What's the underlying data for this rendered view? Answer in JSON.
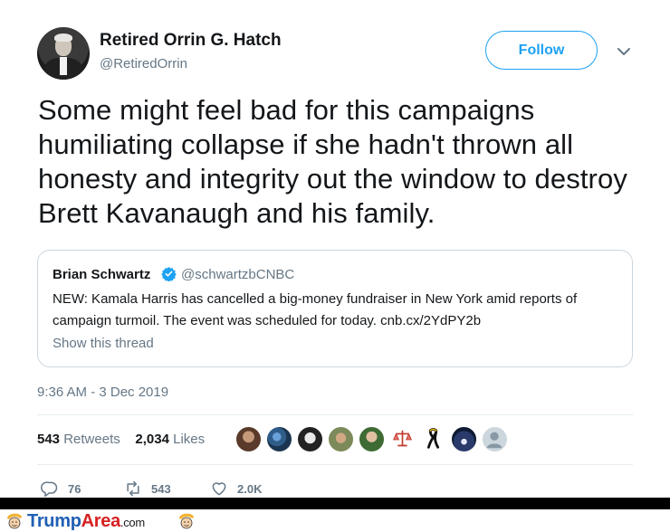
{
  "tweet": {
    "author": {
      "display_name": "Retired Orrin G. Hatch",
      "handle": "@RetiredOrrin"
    },
    "follow_label": "Follow",
    "text": "Some might feel bad for this campaigns humiliating collapse if she hadn't thrown all honesty and integrity out the window to destroy Brett Kavanaugh and his family.",
    "quoted": {
      "display_name": "Brian Schwartz",
      "verified": true,
      "handle": "@schwartzbCNBC",
      "text": "NEW: Kamala Harris has cancelled a big-money fundraiser in New York amid reports of campaign turmoil. The event was scheduled for today. cnb.cx/2YdPY2b",
      "show_thread": "Show this thread"
    },
    "timestamp": "9:36 AM - 3 Dec 2019",
    "stats": {
      "retweets_count": "543",
      "retweets_label": "Retweets",
      "likes_count": "2,034",
      "likes_label": "Likes"
    },
    "liker_avatars": [
      "avatar-1",
      "avatar-2",
      "avatar-3",
      "avatar-4",
      "avatar-5",
      "avatar-6",
      "avatar-7",
      "avatar-8",
      "avatar-9",
      "avatar-10"
    ],
    "actions": {
      "replies": "76",
      "retweets": "543",
      "likes": "2.0K"
    }
  },
  "watermark": {
    "brand_trump": "Trump",
    "brand_area": "Area",
    "brand_tld": ".com"
  },
  "colors": {
    "accent": "#1da1f2",
    "secondary_text": "#657786",
    "border": "#ccd6dd",
    "verified": "#1da1f2",
    "brand_blue": "#1f5fb4",
    "brand_red": "#d62020"
  }
}
